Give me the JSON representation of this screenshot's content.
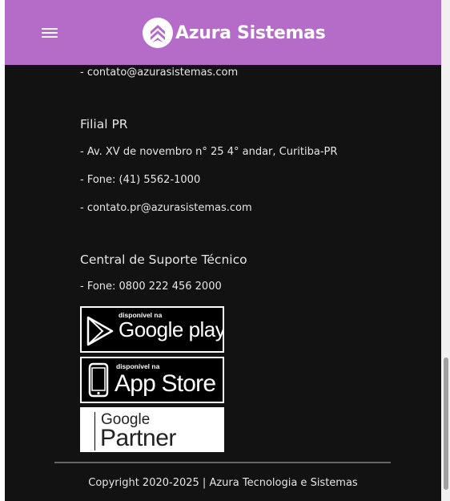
{
  "header": {
    "brand_name": "Azura Sistemas",
    "background_color": "#b56bc8"
  },
  "contact": {
    "email_main": "- contato@azurasistemas.com",
    "branch_pr": {
      "title": "Filial PR",
      "address": "- Av. XV de novembro n° 25 4° andar, Curitiba-PR",
      "phone": "- Fone: (41) 5562-1000",
      "email": "- contato.pr@azurasistemas.com"
    },
    "support": {
      "title": "Central de Suporte Técnico",
      "phone": "- Fone: 0800 222 456 2000"
    }
  },
  "badges": {
    "google_play": {
      "small": "disponível na",
      "big": "Google play"
    },
    "app_store": {
      "small": "disponível na",
      "big": "App Store"
    },
    "google_partner": {
      "line1": "Google",
      "line2": "Partner"
    }
  },
  "footer": {
    "copyright": "Copyright 2020-2025 | Azura Tecnologia e Sistemas"
  },
  "icons": [
    "menu-icon",
    "azura-logo-icon",
    "play-triangle-icon",
    "phone-icon"
  ]
}
